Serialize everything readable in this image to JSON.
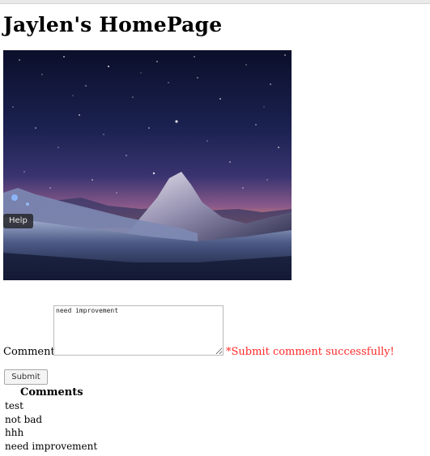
{
  "page": {
    "title": "Jaylen's HomePage"
  },
  "hero": {
    "help_label": "Help"
  },
  "comment_form": {
    "label": "Comment:",
    "value": "need improvement",
    "success_message": "*Submit comment successfully!",
    "submit_label": "Submit"
  },
  "comments": {
    "heading": "Comments",
    "items": [
      "test",
      "not bad",
      "hhh",
      "need improvement"
    ]
  },
  "colors": {
    "success": "#ff2a2a",
    "sky_top": "#0b1030",
    "sky_glow": "#f2965a"
  }
}
